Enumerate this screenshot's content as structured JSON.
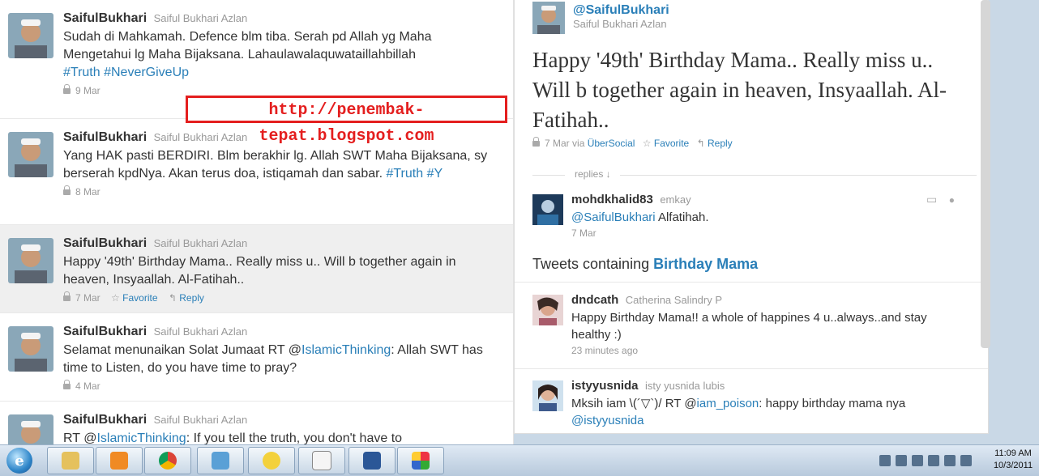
{
  "timeline": {
    "tweets": [
      {
        "username": "SaifulBukhari",
        "fullname": "Saiful Bukhari Azlan",
        "text": "Sudah di Mahkamah. Defence blm tiba. Serah pd Allah yg Maha Mengetahui lg Maha Bijaksana. Lahaulawalaquwataillahbillah",
        "hashtags": "#Truth #NeverGiveUp",
        "date": "9 Mar"
      },
      {
        "username": "SaifulBukhari",
        "fullname": "Saiful Bukhari Azlan",
        "text": "Yang HAK pasti BERDIRI. Blm berakhir lg. Allah SWT Maha Bijaksana, sy berserah kpdNya. Akan terus doa, istiqamah dan sabar.",
        "hashtags": "#Truth #Y",
        "date": "8 Mar"
      },
      {
        "username": "SaifulBukhari",
        "fullname": "Saiful Bukhari Azlan",
        "text": "Happy '49th' Birthday Mama.. Really miss u.. Will b together again in heaven, Insyaallah. Al-Fatihah..",
        "date": "7 Mar",
        "favorite": "Favorite",
        "reply": "Reply"
      },
      {
        "username": "SaifulBukhari",
        "fullname": "Saiful Bukhari Azlan",
        "text_a": "Selamat menunaikan Solat Jumaat RT @",
        "mention": "IslamicThinking",
        "text_b": ": Allah SWT has time to Listen, do you have time to pray?",
        "date": "4 Mar"
      },
      {
        "username": "SaifulBukhari",
        "fullname": "Saiful Bukhari Azlan",
        "text_a": "RT @",
        "mention": "IslamicThinking",
        "text_b": ": If you tell the truth, you don't have to"
      }
    ]
  },
  "watermark": "http://penembak-tepat.blogspot.com",
  "detail": {
    "screen_name": "@SaifulBukhari",
    "fullname": "Saiful Bukhari Azlan",
    "text": "Happy '49th' Birthday Mama.. Really miss u.. Will b together again in heaven, Insyaallah. Al-Fatihah..",
    "date": "7 Mar",
    "via": "via",
    "client": "ÜberSocial",
    "favorite": "Favorite",
    "reply": "Reply",
    "replies_label": "replies ↓",
    "reply_tweet": {
      "username": "mohdkhalid83",
      "fullname": "emkay",
      "mention": "@SaifulBukhari",
      "text": " Alfatihah.",
      "date": "7 Mar"
    },
    "containing_prefix": "Tweets containing ",
    "containing_query": "Birthday Mama",
    "results": [
      {
        "username": "dndcath",
        "fullname": "Catherina Salindry P",
        "text": "Happy Birthday Mama!! a whole of happines 4 u..always..and stay healthy :)",
        "date": "23 minutes ago"
      },
      {
        "username": "istyyusnida",
        "fullname": "isty yusnida lubis",
        "text_a": "Mksih iam \\(´▽`)/ RT @",
        "mention": "iam_poison",
        "text_b": ": happy birthday mama nya",
        "mention2": "@istyyusnida"
      }
    ]
  },
  "taskbar": {
    "start_glyph": "e",
    "clock_time": "11:09 AM",
    "clock_date": "10/3/2011",
    "apps": [
      "internet-explorer",
      "file-explorer",
      "media-player",
      "chrome",
      "photo-viewer",
      "yahoo-messenger",
      "notepad",
      "word",
      "paint"
    ]
  },
  "colors": {
    "link": "#2a7fb8",
    "watermark": "#e41e1e",
    "selected_row": "#efefef"
  }
}
